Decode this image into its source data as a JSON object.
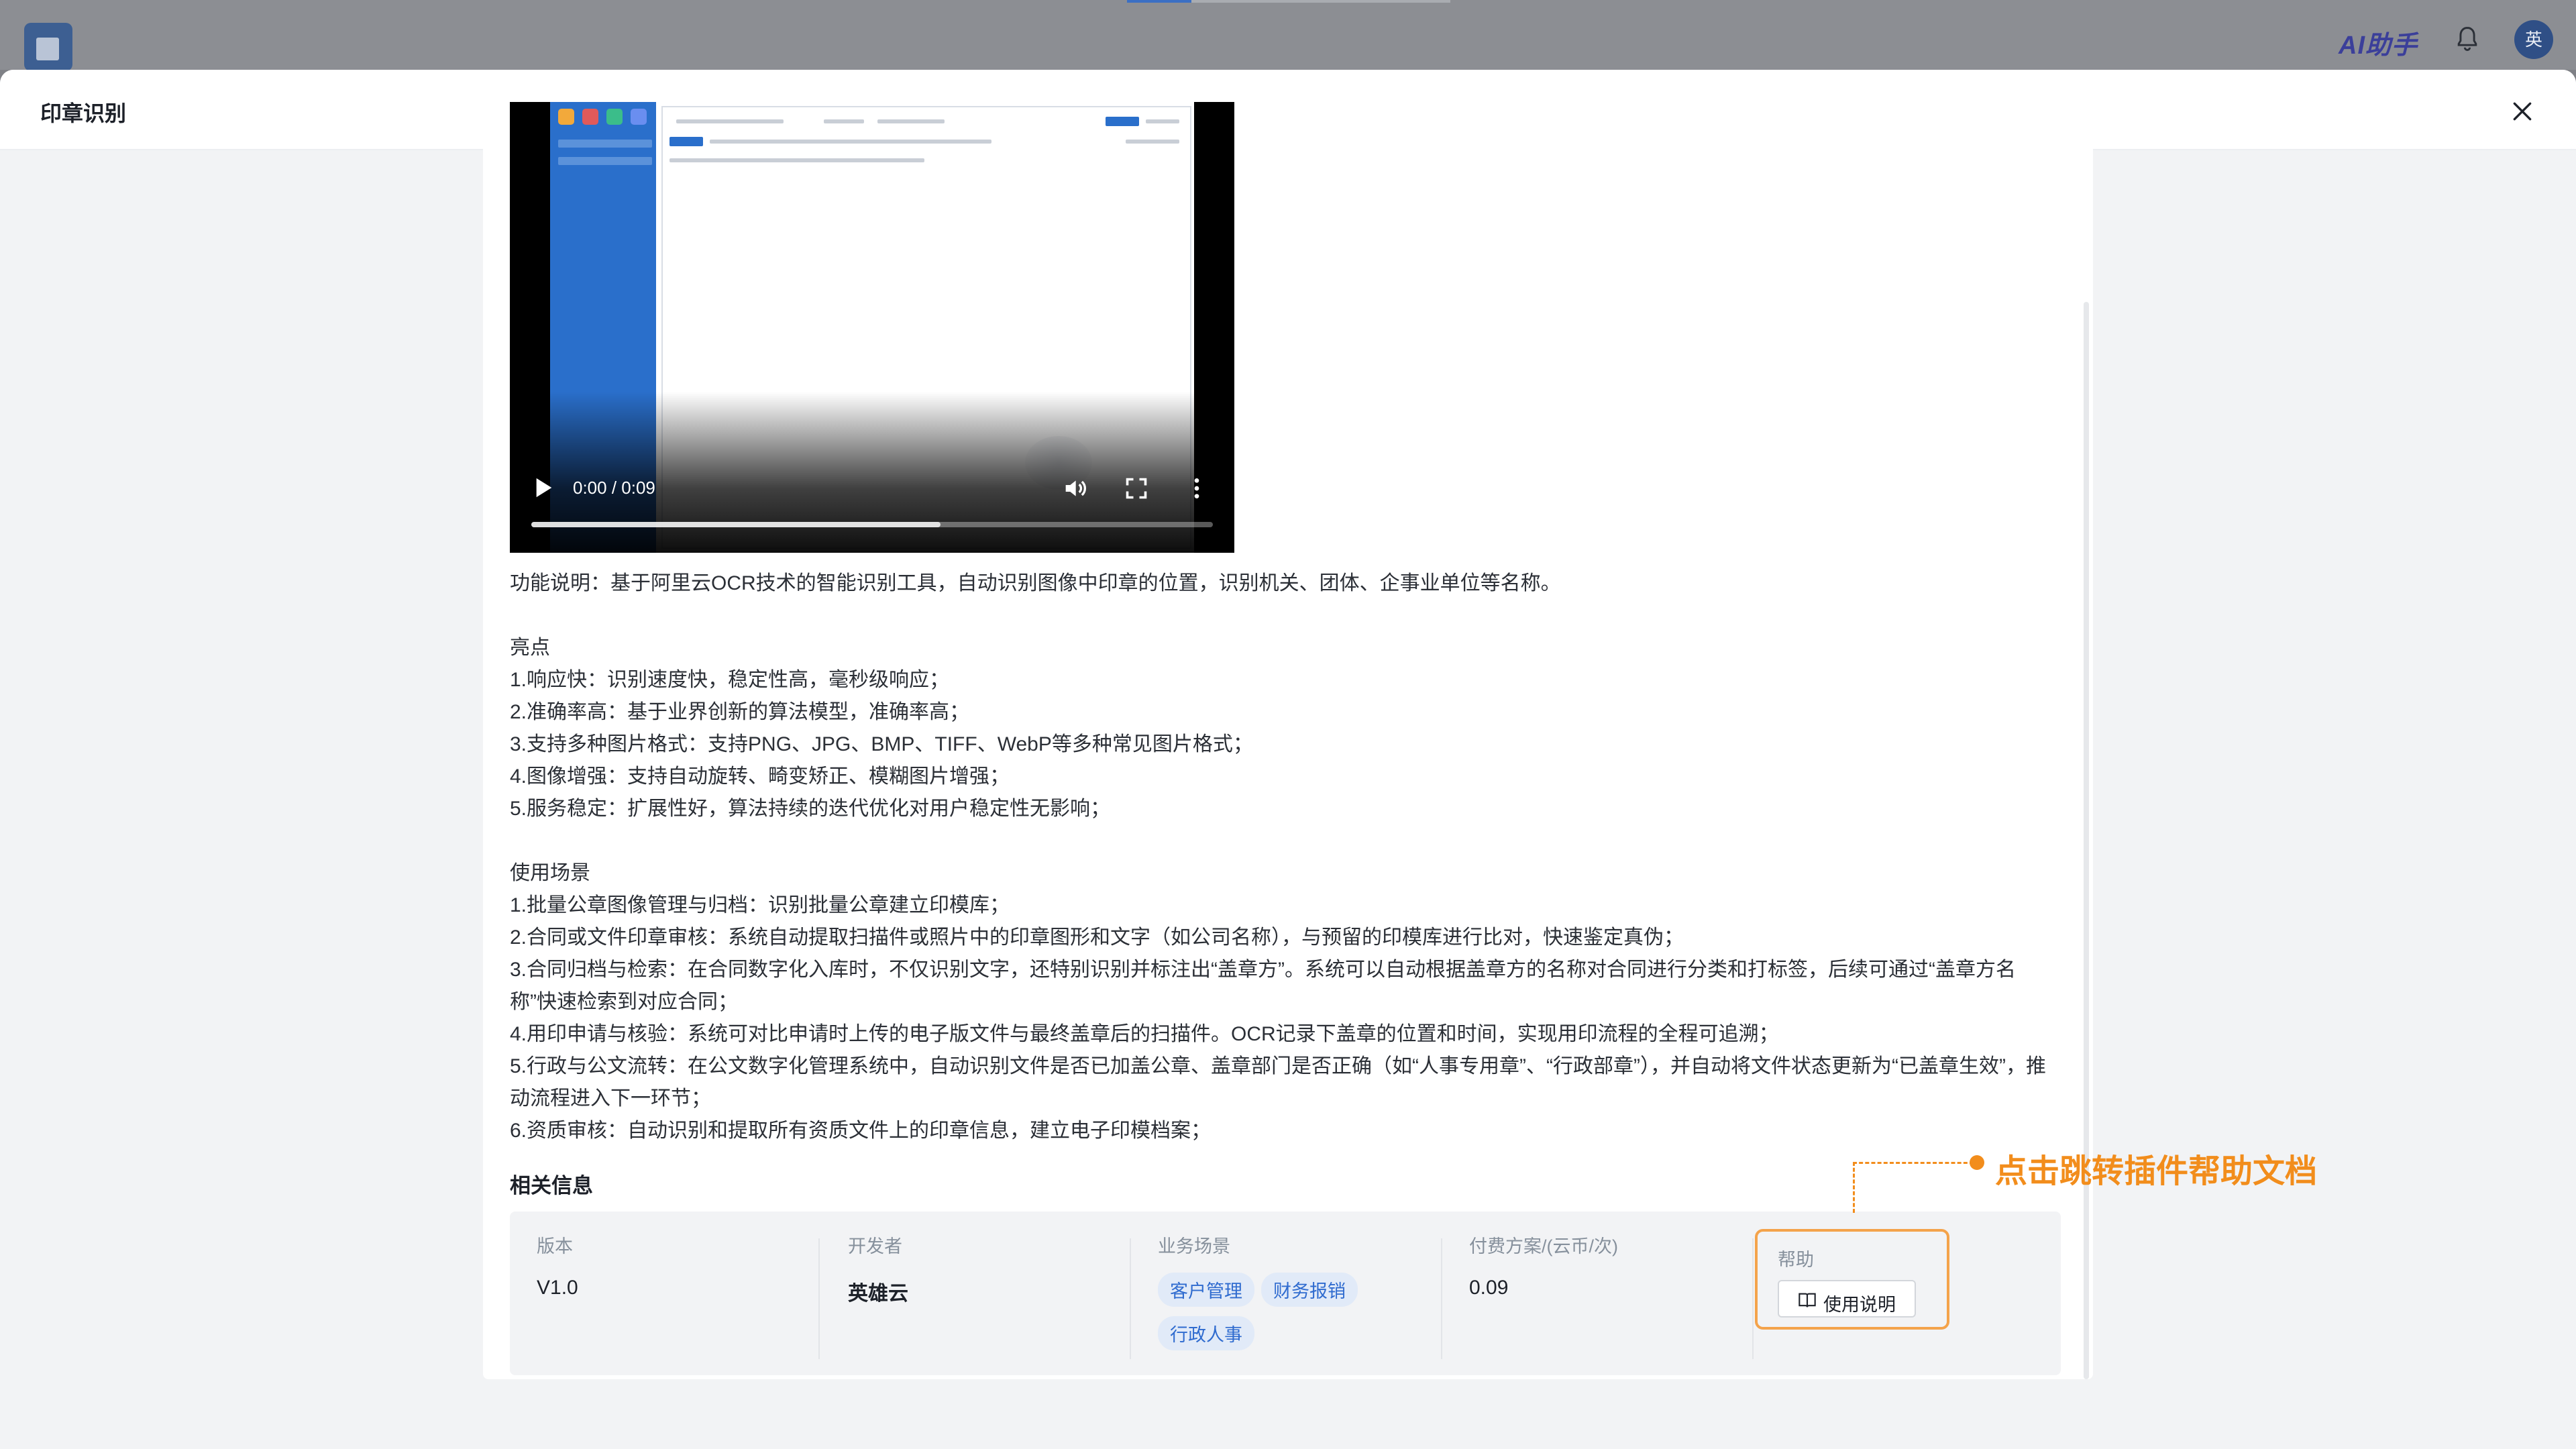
{
  "app": {
    "ai_helper_label": "AI助手",
    "avatar_text": "英"
  },
  "drawer": {
    "title": "印章识别"
  },
  "video": {
    "time": "0:00 / 0:09",
    "progress": 0.6
  },
  "description": "功能说明：基于阿里云OCR技术的智能识别工具，自动识别图像中印章的位置，识别机关、团体、企事业单位等名称。",
  "highlights": {
    "title": "亮点",
    "items": [
      "1.响应快：识别速度快，稳定性高，毫秒级响应；",
      "2.准确率高：基于业界创新的算法模型，准确率高；",
      "3.支持多种图片格式：支持PNG、JPG、BMP、TIFF、WebP等多种常见图片格式；",
      "4.图像增强：支持自动旋转、畸变矫正、模糊图片增强；",
      "5.服务稳定：扩展性好，算法持续的迭代优化对用户稳定性无影响；"
    ]
  },
  "scenarios": {
    "title": "使用场景",
    "items": [
      "1.批量公章图像管理与归档：识别批量公章建立印模库；",
      "2.合同或文件印章审核：系统自动提取扫描件或照片中的印章图形和文字（如公司名称），与预留的印模库进行比对，快速鉴定真伪；",
      "3.合同归档与检索：在合同数字化入库时，不仅识别文字，还特别识别并标注出“盖章方”。系统可以自动根据盖章方的名称对合同进行分类和打标签，后续可通过“盖章方名称”快速检索到对应合同；",
      "4.用印申请与核验：系统可对比申请时上传的电子版文件与最终盖章后的扫描件。OCR记录下盖章的位置和时间，实现用印流程的全程可追溯；",
      "5.行政与公文流转：在公文数字化管理系统中，自动识别文件是否已加盖公章、盖章部门是否正确（如“人事专用章”、“行政部章”），并自动将文件状态更新为“已盖章生效”，推动流程进入下一环节；",
      "6.资质审核：自动识别和提取所有资质文件上的印章信息，建立电子印模档案；"
    ]
  },
  "related": {
    "title": "相关信息",
    "version_label": "版本",
    "version_value": "V1.0",
    "developer_label": "开发者",
    "developer_value": "英雄云",
    "scenario_label": "业务场景",
    "scenario_tags": [
      "客户管理",
      "财务报销",
      "行政人事"
    ],
    "price_label": "付费方案/(云币/次)",
    "price_value": "0.09",
    "help_label": "帮助",
    "usage_button": "使用说明"
  },
  "annotation": {
    "text": "点击跳转插件帮助文档",
    "color": "#f28d1c"
  }
}
